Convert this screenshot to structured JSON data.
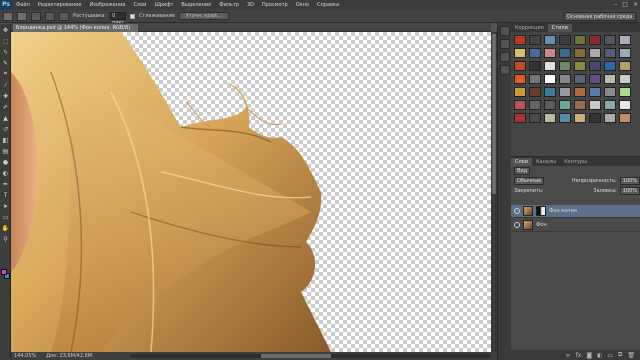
{
  "menu": {
    "items": [
      "Файл",
      "Редактирование",
      "Изображение",
      "Слои",
      "Шрифт",
      "Выделение",
      "Фильтр",
      "3D",
      "Просмотр",
      "Окно",
      "Справка"
    ],
    "logo": "Ps"
  },
  "options": {
    "feather_label": "Растушевка:",
    "feather_value": "0 пикс.",
    "antialias_label": "Сглаживание",
    "refine_button": "Уточн. край...",
    "workspace": "Основная рабочая среда"
  },
  "document": {
    "tab_title": "Блондинка.psd @ 144% (Фон копия, RGB/8)"
  },
  "status": {
    "zoom": "144,05%",
    "doc_size": "Док: 23,6M/42,8M"
  },
  "panels": {
    "top_tabs": [
      "Коррекция",
      "Стили"
    ],
    "top_active": "Стили",
    "layer_tabs": [
      "Слои",
      "Каналы",
      "Контуры"
    ],
    "layer_active": "Слои",
    "kind_label": "Вид",
    "blend_mode": "Обычные",
    "opacity_label": "Непрозрачность:",
    "opacity_value": "100%",
    "lock_label": "Закрепить:",
    "fill_label": "Заливка:",
    "fill_value": "100%",
    "layers": [
      {
        "name": "Фон копия",
        "active": true,
        "has_mask": true
      },
      {
        "name": "Фон",
        "active": false,
        "has_mask": false
      }
    ]
  },
  "colors": {
    "foreground": "#c050d0",
    "background": "#3a8bd8",
    "hair_light": "#e6c27a",
    "hair_dark": "#8a5a2b",
    "skin": "#e2a877"
  },
  "styles_swatches": [
    "#b83a2a",
    "#444",
    "#6b8bb0",
    "#3a3a3a",
    "#6b7a3a",
    "#8b2a2a",
    "#556",
    "#aab",
    "#d6c06a",
    "#4b6a9a",
    "#c88",
    "#3a6a8a",
    "#8a6a3a",
    "#aaa",
    "#5a5a7a",
    "#9ab",
    "#c24a2a",
    "#333",
    "#e0e0e0",
    "#6a8a6a",
    "#8a8a3a",
    "#4a4a6a",
    "#2a6aaa",
    "#b0a070",
    "#e35a2a",
    "#777",
    "#fff",
    "#888",
    "#556677",
    "#6a4a8a",
    "#bba",
    "#ccc",
    "#c93",
    "#6a3a2a",
    "#3a7a9a",
    "#9a9a9a",
    "#aa6a3a",
    "#5a7aaa",
    "#8a8a8a",
    "#ad8",
    "#b55",
    "#777a",
    "#5c5c5c",
    "#6a9",
    "#9a6a4a",
    "#c9c9c9",
    "#8aa",
    "#e8e8e8",
    "#a33",
    "#4a4a4a",
    "#bb9",
    "#58a",
    "#d0b080",
    "#333",
    "#aaa",
    "#c86"
  ]
}
